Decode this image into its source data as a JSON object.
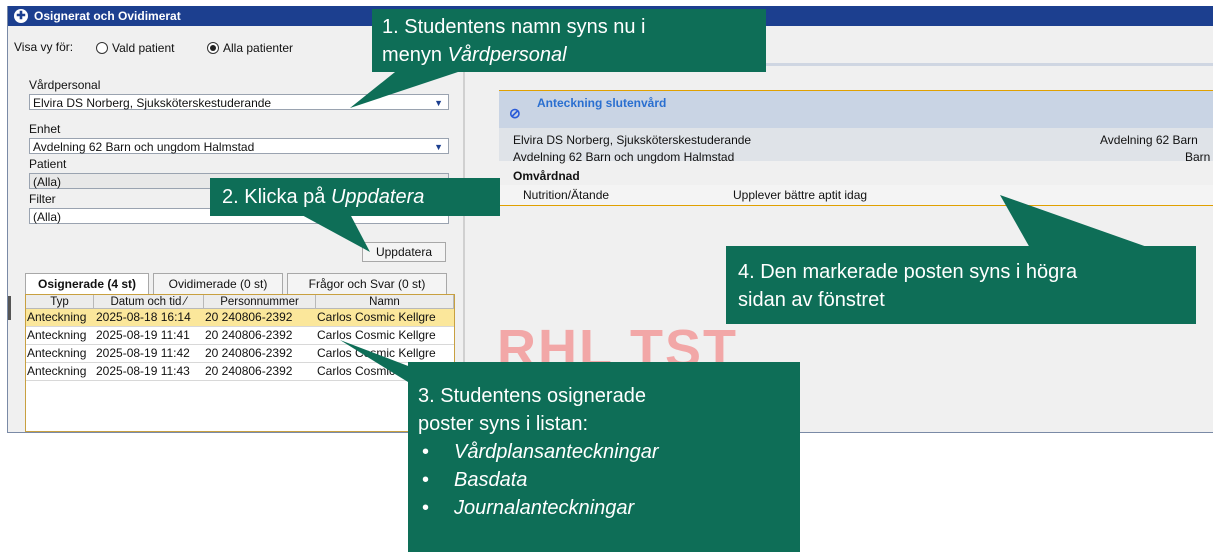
{
  "window": {
    "title": "Osignerat och Ovidimerat"
  },
  "view_for": {
    "label": "Visa vy för:",
    "option_selected_patient": "Vald patient",
    "option_all_patients": "Alla patienter",
    "selected": "Alla patienter"
  },
  "filters": {
    "vardpersonal_label": "Vårdpersonal",
    "vardpersonal_value": "Elvira DS Norberg, Sjuksköterskestuderande",
    "enhet_label": "Enhet",
    "enhet_value": "Avdelning 62 Barn och ungdom Halmstad",
    "patient_label": "Patient",
    "patient_value": "(Alla)",
    "filter_label": "Filter",
    "filter_value": "(Alla)"
  },
  "update_button": "Uppdatera",
  "tabs": [
    {
      "label": "Osignerade  (4 st)",
      "active": true
    },
    {
      "label": "Ovidimerade  (0 st)",
      "active": false
    },
    {
      "label": "Frågor och Svar  (0 st)",
      "active": false
    }
  ],
  "table": {
    "columns": [
      "Typ",
      "Datum och tid ⁄",
      "Personnummer",
      "Namn"
    ],
    "rows": [
      {
        "typ": "Anteckning",
        "datum": "2025-08-18 16:14",
        "pnr": "20 240806-2392",
        "namn": "Carlos Cosmic Kellgre",
        "selected": true
      },
      {
        "typ": "Anteckning",
        "datum": "2025-08-19 11:41",
        "pnr": "20 240806-2392",
        "namn": "Carlos Cosmic Kellgre",
        "selected": false
      },
      {
        "typ": "Anteckning",
        "datum": "2025-08-19 11:42",
        "pnr": "20 240806-2392",
        "namn": "Carlos Cosmic Kellgre",
        "selected": false
      },
      {
        "typ": "Anteckning",
        "datum": "2025-08-19 11:43",
        "pnr": "20 240806-2392",
        "namn": "Carlos Cosmic Kellgre",
        "selected": false
      }
    ]
  },
  "detail": {
    "title": "Anteckning slutenvård",
    "author": "Elvira DS Norberg, Sjuksköterskestuderande",
    "unit_right": "Avdelning 62 Barn",
    "unit": "Avdelning 62 Barn och ungdom Halmstad",
    "unit_right_2": "Barn",
    "section": "Omvårdnad",
    "keyword": "Nutrition/Ätande",
    "text": "Upplever bättre aptit idag"
  },
  "watermark": "RHL TST",
  "callouts": {
    "c1_line1": "1. Studentens namn syns nu i",
    "c1_line2_prefix": "menyn ",
    "c1_line2_italic": "Vårdpersonal",
    "c2_prefix": "2. Klicka på ",
    "c2_italic": "Uppdatera",
    "c3_line1": "3. Studentens osignerade",
    "c3_line2": "poster syns i listan:",
    "c3_bullets": [
      "Vårdplansanteckningar",
      "Basdata",
      "Journalanteckningar"
    ],
    "c4_line1": "4. Den markerade posten syns i högra",
    "c4_line2": "sidan av fönstret"
  },
  "colors": {
    "titlebar": "#1c3f8f",
    "callout": "#0e6e57",
    "selected_row": "#fbe79b",
    "watermark": "#f2a7a7"
  }
}
